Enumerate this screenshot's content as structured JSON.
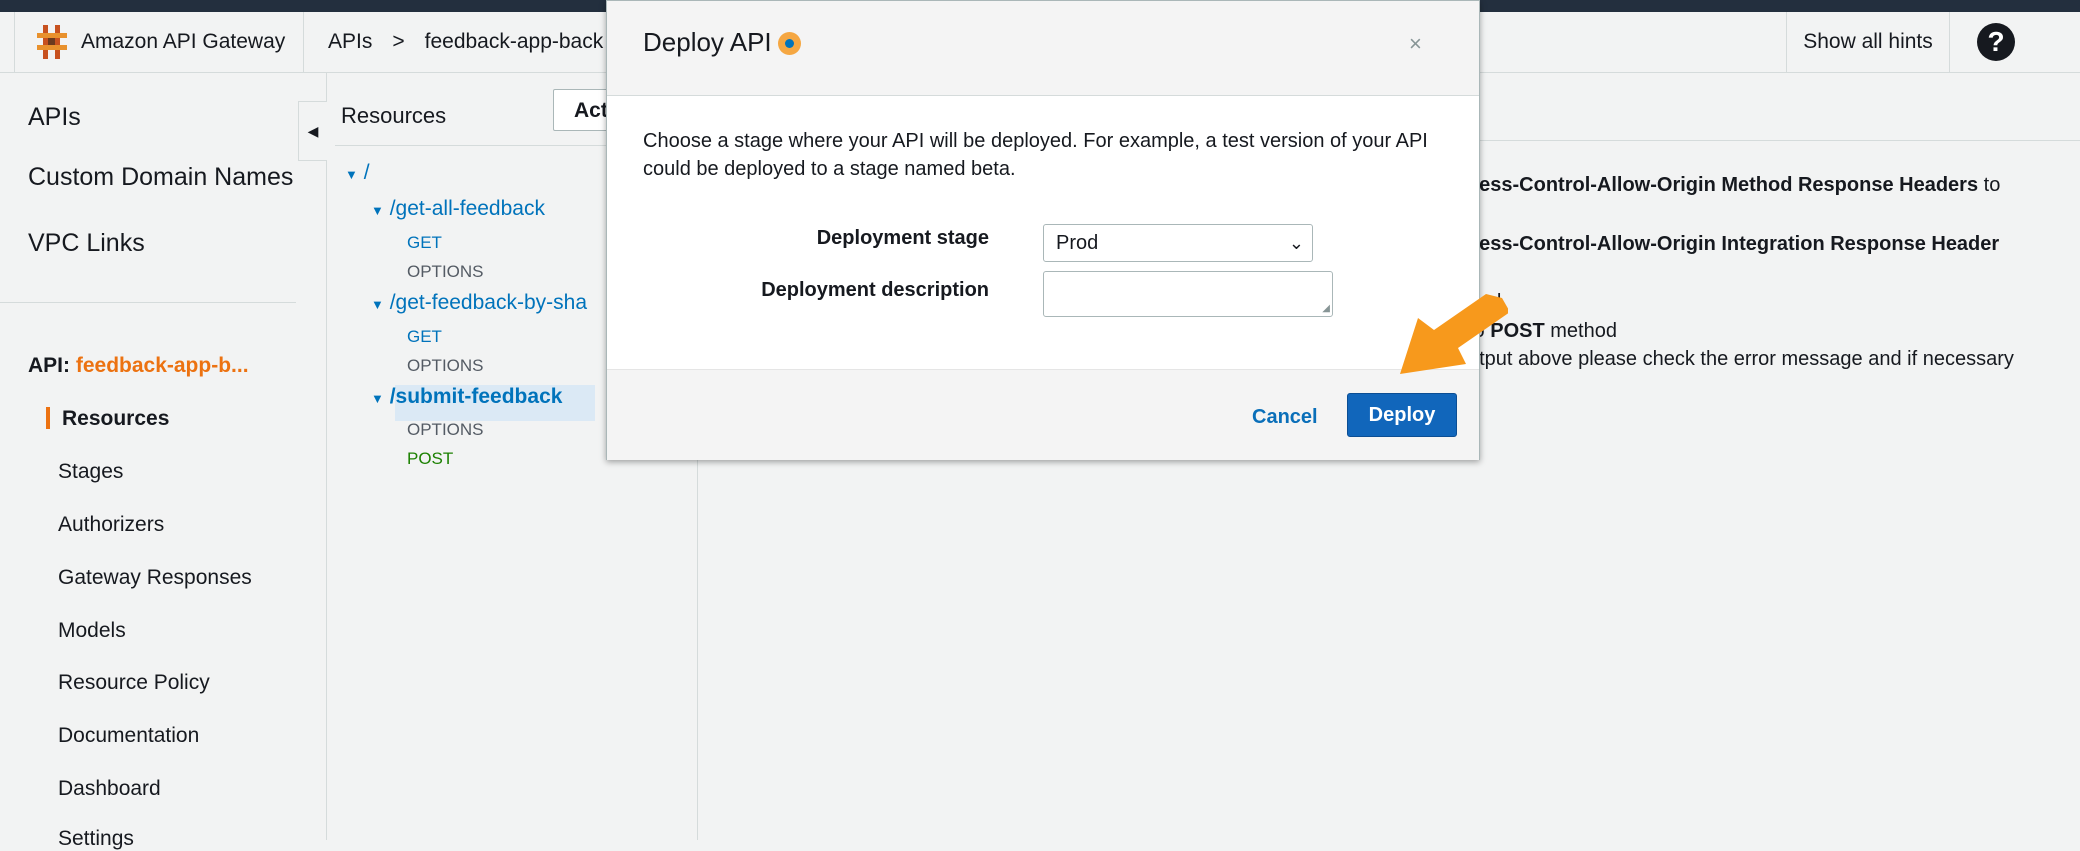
{
  "header": {
    "brand": "Amazon API Gateway",
    "breadcrumb": [
      "APIs",
      ">",
      "feedback-app-back"
    ],
    "hints": "Show all hints",
    "help": "?"
  },
  "leftnav": {
    "top_items": [
      "APIs",
      "Custom Domain Names",
      "VPC Links"
    ],
    "api_label": "API:",
    "api_name": "feedback-app-b...",
    "sub_items": [
      "Resources",
      "Stages",
      "Authorizers",
      "Gateway Responses",
      "Models",
      "Resource Policy",
      "Documentation",
      "Dashboard",
      "Settings"
    ],
    "active": "Resources"
  },
  "resources": {
    "title": "Resources",
    "actions": "Act",
    "root": "/",
    "nodes": [
      {
        "path": "/get-all-feedback",
        "methods": [
          "GET",
          "OPTIONS"
        ]
      },
      {
        "path": "/get-feedback-by-sha",
        "methods": [
          "GET",
          "OPTIONS"
        ]
      },
      {
        "path": "/submit-feedback",
        "methods": [
          "OPTIONS",
          "POST"
        ]
      }
    ],
    "selected": "/submit-feedback"
  },
  "content": {
    "line1_bold": "cess-Control-Allow-Origin Method Response Headers",
    "line1_rest": " to",
    "line2_bold": "cess-Control-Allow-Origin Integration Response Header",
    "line3": "hod",
    "line4_pre": "to ",
    "line4_bold": "POST",
    "line4_post": " method",
    "line5": "utput above please check the error message and if necessary"
  },
  "modal": {
    "title": "Deploy API",
    "close": "×",
    "description": "Choose a stage where your API will be deployed. For example, a test version of your API could be deployed to a stage named beta.",
    "stage_label": "Deployment stage",
    "stage_value": "Prod",
    "desc_label": "Deployment description",
    "desc_value": "",
    "cancel": "Cancel",
    "deploy": "Deploy"
  },
  "colors": {
    "accent": "#ec7211",
    "link": "#0073bb",
    "primary_button": "#1166bb",
    "arrow": "#f7991c"
  }
}
